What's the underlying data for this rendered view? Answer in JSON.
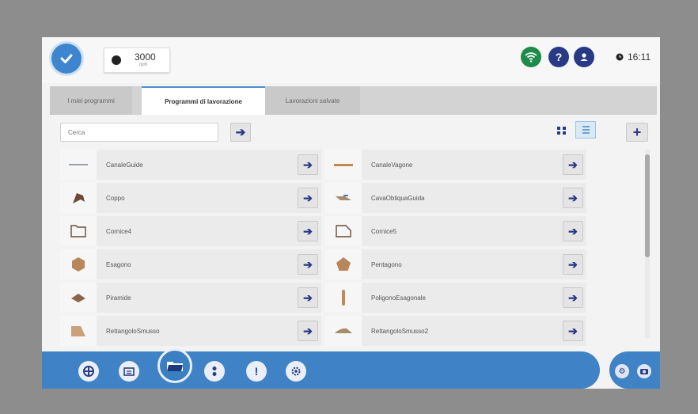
{
  "header": {
    "counter_value": "3000",
    "counter_unit": "rpm",
    "time": "16:11"
  },
  "tabs": [
    {
      "label": "I miei programmi",
      "active": false
    },
    {
      "label": "Programmi di lavorazione",
      "active": true
    },
    {
      "label": "Lavorazioni salvate",
      "active": false
    }
  ],
  "search": {
    "placeholder": "Cerca"
  },
  "programs_left": [
    {
      "name": "CanaleGuide",
      "icon": "groove-shape-icon"
    },
    {
      "name": "Coppo",
      "icon": "tile-shape-icon"
    },
    {
      "name": "Cornice4",
      "icon": "frame4-shape-icon"
    },
    {
      "name": "Esagono",
      "icon": "hexagon-shape-icon"
    },
    {
      "name": "Piramide",
      "icon": "pyramid-shape-icon"
    },
    {
      "name": "RettangoloSmusso",
      "icon": "bevel-rect-shape-icon"
    }
  ],
  "programs_right": [
    {
      "name": "CanaleVagone",
      "icon": "groove-wagon-shape-icon"
    },
    {
      "name": "CavaObliquaGuida",
      "icon": "oblique-cut-shape-icon"
    },
    {
      "name": "Cornice5",
      "icon": "frame5-shape-icon"
    },
    {
      "name": "Pentagono",
      "icon": "pentagon-shape-icon"
    },
    {
      "name": "PoligonoEsagonale",
      "icon": "hex-polygon-shape-icon"
    },
    {
      "name": "RettangoloSmusso2",
      "icon": "bevel-rect2-shape-icon"
    }
  ],
  "colors": {
    "accent": "#3f83c6",
    "navy": "#283a86",
    "wifi": "#1f8b4a"
  }
}
